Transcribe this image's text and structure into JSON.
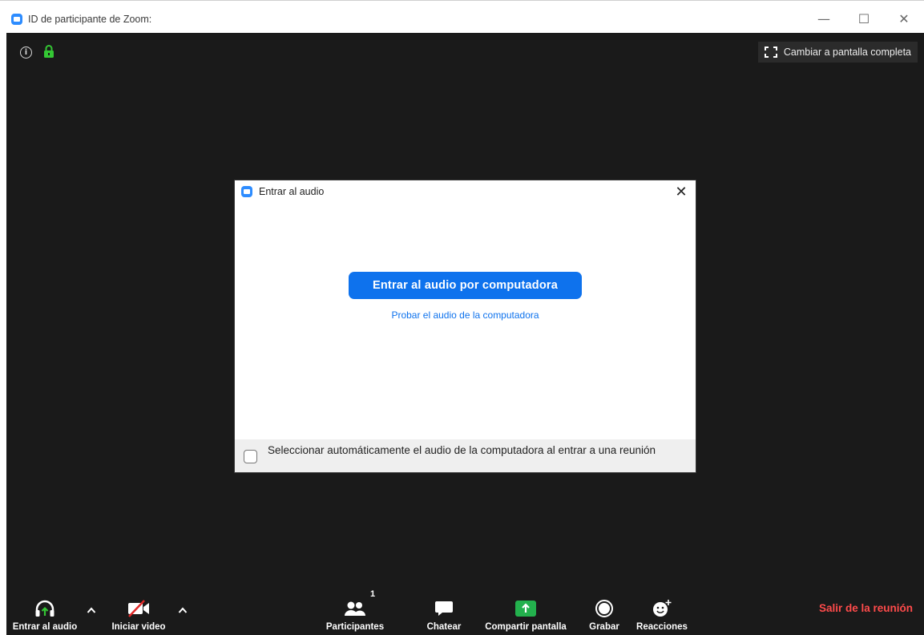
{
  "window": {
    "title": "ID de participante de Zoom:",
    "minimize_glyph": "—",
    "maximize_glyph": "☐",
    "close_glyph": "✕"
  },
  "meeting": {
    "info_glyph": "i",
    "fullscreen_label": "Cambiar a pantalla completa"
  },
  "dialog": {
    "title": "Entrar al audio",
    "close_glyph": "✕",
    "join_button": "Entrar al audio por computadora",
    "test_link": "Probar el audio de la computadora",
    "auto_select_label": "Seleccionar automáticamente el audio de la computadora al entrar a una reunión",
    "auto_select_checked": false
  },
  "toolbar": {
    "join_audio": "Entrar al audio",
    "start_video": "Iniciar video",
    "participants": "Participantes",
    "participants_count": "1",
    "chat": "Chatear",
    "share_screen": "Compartir pantalla",
    "record": "Grabar",
    "reactions": "Reacciones",
    "leave": "Salir de la reunión"
  },
  "colors": {
    "accent": "#0e72ed",
    "share_green": "#23b14d",
    "leave_red": "#ff4b4b",
    "meeting_bg": "#1a1a1a"
  }
}
